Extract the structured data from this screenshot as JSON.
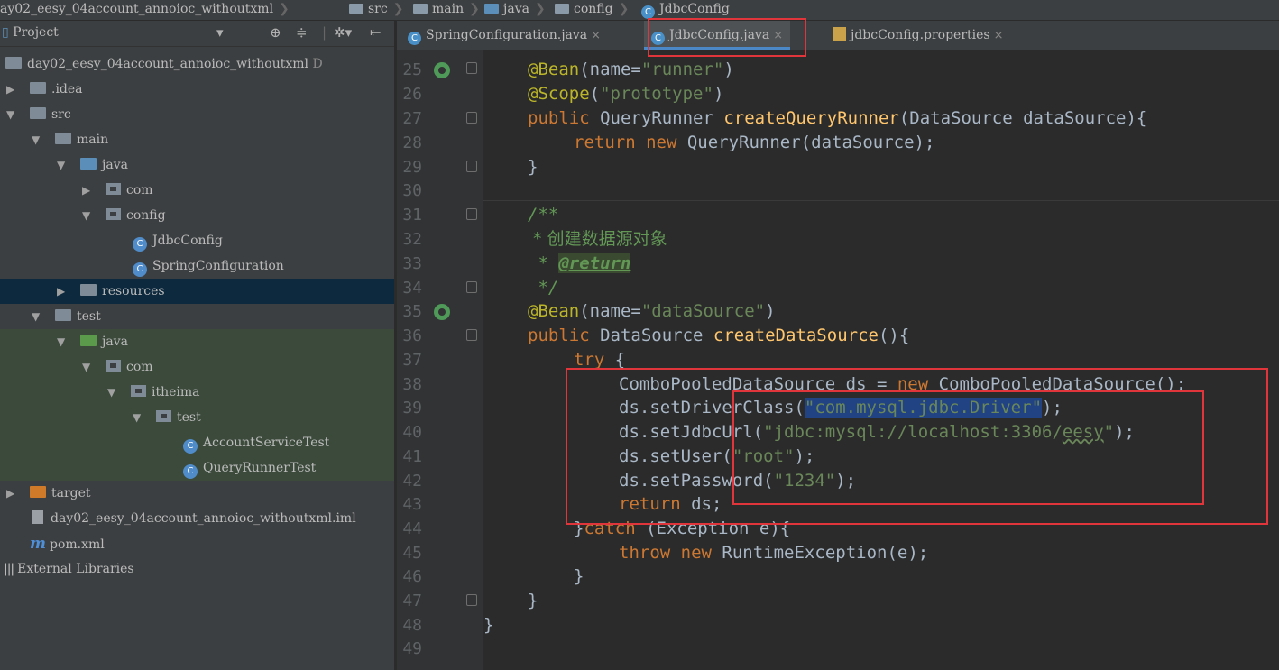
{
  "breadcrumb": [
    "ay02_eesy_04account_annoioc_withoutxml",
    "src",
    "main",
    "java",
    "config",
    "JdbcConfig"
  ],
  "project_panel": {
    "title": "Project",
    "toolbar_icons": [
      "target-icon",
      "collapse-icon",
      "gear-icon",
      "hide-icon"
    ],
    "tree": [
      {
        "label": "day02_eesy_04account_annoioc_withoutxml",
        "suffix": "D"
      },
      {
        "label": ".idea"
      },
      {
        "label": "src"
      },
      {
        "label": "main"
      },
      {
        "label": "java"
      },
      {
        "label": "com"
      },
      {
        "label": "config"
      },
      {
        "label": "JdbcConfig"
      },
      {
        "label": "SpringConfiguration"
      },
      {
        "label": "resources"
      },
      {
        "label": "test"
      },
      {
        "label": "java"
      },
      {
        "label": "com"
      },
      {
        "label": "itheima"
      },
      {
        "label": "test"
      },
      {
        "label": "AccountServiceTest"
      },
      {
        "label": "QueryRunnerTest"
      },
      {
        "label": "target"
      },
      {
        "label": "day02_eesy_04account_annoioc_withoutxml.iml"
      },
      {
        "label": "pom.xml"
      },
      {
        "label": "External Libraries"
      }
    ]
  },
  "tabs": [
    {
      "label": "SpringConfiguration.java",
      "close": "×"
    },
    {
      "label": "JdbcConfig.java",
      "close": "×"
    },
    {
      "label": "jdbcConfig.properties",
      "close": "×"
    }
  ],
  "editor": {
    "line_numbers": [
      "25",
      "26",
      "27",
      "28",
      "29",
      "30",
      "31",
      "32",
      "33",
      "34",
      "35",
      "36",
      "37",
      "38",
      "39",
      "40",
      "41",
      "42",
      "43",
      "44",
      "45",
      "46",
      "47",
      "48",
      "49"
    ],
    "code": {
      "l25_ann": "@Bean",
      "l25_rest": "(name=",
      "l25_str": "\"runner\"",
      "l25_end": ")",
      "l26_ann": "@Scope",
      "l26_open": "(",
      "l26_str": "\"prototype\"",
      "l26_end": ")",
      "l27_kw": "public",
      "l27_type": " QueryRunner ",
      "l27_fn": "createQueryRunner",
      "l27_rest": "(DataSource dataSource){",
      "l28_kw1": "return",
      "l28_kw2": "new",
      "l28_rest": " QueryRunner(dataSource);",
      "l29": "}",
      "l31": "/**",
      "l32": " * 创建数据源对象",
      "l33_star": " * ",
      "l33_tag": "@return",
      "l34": " */",
      "l35_ann": "@Bean",
      "l35_rest": "(name=",
      "l35_str": "\"dataSource\"",
      "l35_end": ")",
      "l36_kw": "public",
      "l36_type": " DataSource ",
      "l36_fn": "createDataSource",
      "l36_rest": "(){",
      "l37_kw": "try",
      "l37_rest": " {",
      "l38_a": "ComboPooledDataSource ds = ",
      "l38_kw": "new",
      "l38_b": " ComboPooledDataSource();",
      "l39_a": "ds.setDriverClass(",
      "l39_str": "\"com.mysql.jdbc.Driver\"",
      "l39_b": ");",
      "l40_a": "ds.setJdbcUrl(",
      "l40_str1": "\"jdbc:mysql://localhost:3306/",
      "l40_sq": "eesy",
      "l40_str2": "\"",
      "l40_b": ");",
      "l41_a": "ds.setUser(",
      "l41_str": "\"root\"",
      "l41_b": ");",
      "l42_a": "ds.setPassword(",
      "l42_str": "\"1234\"",
      "l42_b": ");",
      "l43_kw": "return",
      "l43_rest": " ds;",
      "l44_a": "}",
      "l44_kw": "catch",
      "l44_b": " (Exception e){",
      "l45_kw1": "throw",
      "l45_kw2": "new",
      "l45_rest": " RuntimeException(e);",
      "l46": "}",
      "l47": "}",
      "l48": "}"
    }
  },
  "colors": {
    "keyword": "#cc7832",
    "annotation": "#bbb529",
    "string": "#6a8759",
    "function": "#ffc66d",
    "highlight": "#e0353b"
  }
}
